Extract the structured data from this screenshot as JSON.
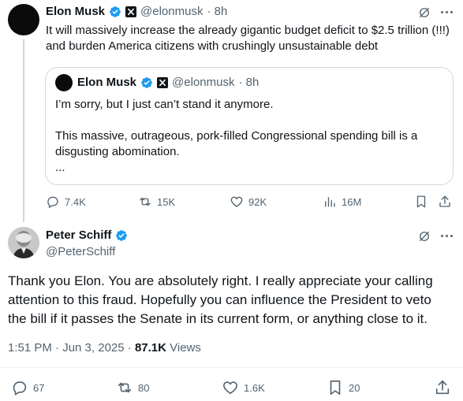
{
  "parent_tweet": {
    "author_name": "Elon Musk",
    "author_handle": "@elonmusk",
    "time": "· 8h",
    "text_line1": "It will massively increase the already gigantic budget deficit to $2.5 trillion (!!!)",
    "text_line2": "and burden America citizens with crushingly unsustainable debt",
    "quote": {
      "author_name": "Elon Musk",
      "author_handle": "@elonmusk",
      "time": "· 8h",
      "line1": "I’m sorry, but I just can’t stand it anymore.",
      "line2": "This massive, outrageous, pork-filled Congressional spending bill is a",
      "line3": "disgusting abomination.",
      "line4": "..."
    },
    "actions": {
      "replies": "7.4K",
      "reposts": "15K",
      "likes": "92K",
      "views": "16M"
    }
  },
  "reply_tweet": {
    "author_name": "Peter Schiff",
    "author_handle": "@PeterSchiff",
    "text_line1": "Thank you Elon. You are absolutely right. I really appreciate your calling",
    "text_line2": "attention to this fraud. Hopefully you can influence the President to veto",
    "text_line3": "the bill if it passes the Senate in its current form, or anything close to it.",
    "timestamp": "1:51 PM · Jun 3, 2025 ·",
    "views_count": "87.1K",
    "views_label": "Views",
    "actions": {
      "replies": "67",
      "reposts": "80",
      "likes": "1.6K",
      "bookmarks": "20"
    }
  },
  "colors": {
    "verified_badge": "#1d9bf0",
    "muted_text": "#536471",
    "border": "#cfd9de"
  }
}
